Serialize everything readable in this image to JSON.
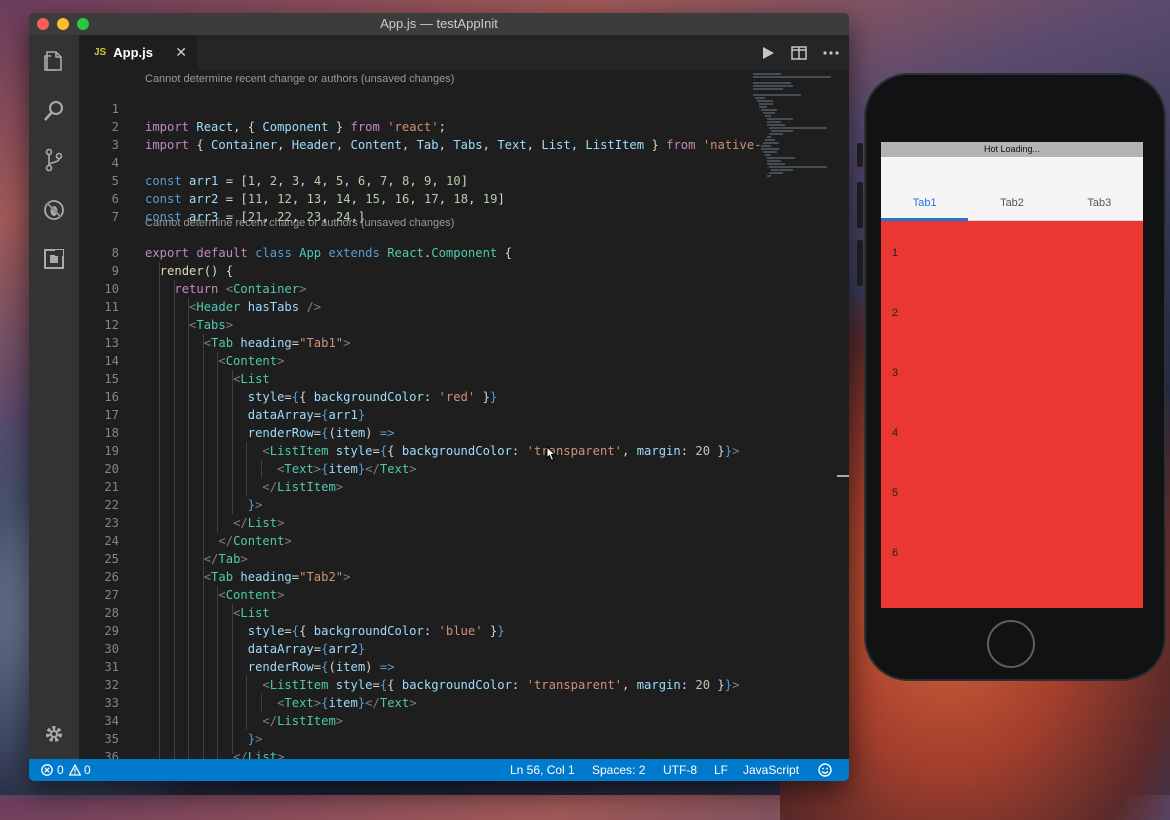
{
  "window": {
    "title": "App.js — testAppInit"
  },
  "tab": {
    "filetype": "JS",
    "filename": "App.js",
    "close": "✕"
  },
  "editor": {
    "lens1": "Cannot determine recent change or authors (unsaved changes)",
    "lens2": "Cannot determine recent change or authors (unsaved changes)"
  },
  "status": {
    "errors": "0",
    "warnings": "0",
    "position": "Ln 56, Col 1",
    "spaces": "Spaces: 2",
    "encoding": "UTF-8",
    "eol": "LF",
    "language": "JavaScript"
  },
  "simulator": {
    "banner": "Hot Loading...",
    "tabs": [
      "Tab1",
      "Tab2",
      "Tab3"
    ],
    "items": [
      "1",
      "2",
      "3",
      "4",
      "5",
      "6"
    ]
  },
  "colors": {
    "statusbar": "#007acc",
    "list_bg": "#eb3732",
    "active_tab": "#2177d9"
  }
}
